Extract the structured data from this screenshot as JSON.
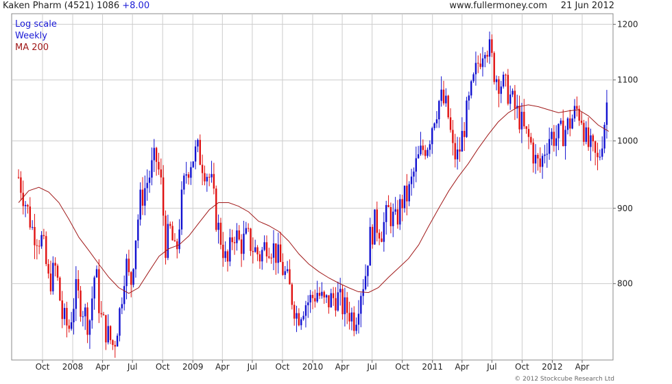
{
  "header": {
    "instrument": "Kaken Pharm (4521) 1086",
    "change": "+8.00",
    "site": "www.fullermoney.com",
    "date": "21 Jun 2012"
  },
  "legend": {
    "scale": "Log scale",
    "period": "Weekly",
    "ma": "MA 200"
  },
  "copyright": "© 2012 Stockcube Research Ltd",
  "colors": {
    "up": "#1010d0",
    "down": "#e01010",
    "ma": "#a01818",
    "grid": "#cccccc",
    "legend_scale": "#1a1ad6",
    "legend_period": "#1a1ad6",
    "legend_ma": "#a01818"
  },
  "chart_data": {
    "type": "candlestick",
    "y_scale": "log",
    "ylim": [
      710,
      1220
    ],
    "y_ticks": [
      800,
      900,
      1000,
      1100,
      1200
    ],
    "x_ticks": [
      {
        "label": "Oct",
        "date": "2007-10-01"
      },
      {
        "label": "2008",
        "date": "2008-01-01"
      },
      {
        "label": "Apr",
        "date": "2008-04-01"
      },
      {
        "label": "Jul",
        "date": "2008-07-01"
      },
      {
        "label": "Oct",
        "date": "2008-10-01"
      },
      {
        "label": "2009",
        "date": "2009-01-01"
      },
      {
        "label": "Apr",
        "date": "2009-04-01"
      },
      {
        "label": "Jul",
        "date": "2009-07-01"
      },
      {
        "label": "Oct",
        "date": "2009-10-01"
      },
      {
        "label": "2010",
        "date": "2010-01-01"
      },
      {
        "label": "Apr",
        "date": "2010-04-01"
      },
      {
        "label": "Jul",
        "date": "2010-07-01"
      },
      {
        "label": "Oct",
        "date": "2010-10-01"
      },
      {
        "label": "2011",
        "date": "2011-01-01"
      },
      {
        "label": "Apr",
        "date": "2011-04-01"
      },
      {
        "label": "Jul",
        "date": "2011-07-01"
      },
      {
        "label": "Oct",
        "date": "2011-10-01"
      },
      {
        "label": "2012",
        "date": "2012-01-01"
      },
      {
        "label": "Apr",
        "date": "2012-04-01"
      }
    ],
    "grid": true,
    "close_series": [
      [
        "2007-07-20",
        945
      ],
      [
        "2007-09-01",
        870
      ],
      [
        "2007-10-01",
        855
      ],
      [
        "2007-10-20",
        800
      ],
      [
        "2007-11-10",
        820
      ],
      [
        "2007-11-30",
        760
      ],
      [
        "2007-12-20",
        745
      ],
      [
        "2008-01-10",
        790
      ],
      [
        "2008-02-01",
        770
      ],
      [
        "2008-02-20",
        750
      ],
      [
        "2008-03-10",
        820
      ],
      [
        "2008-03-25",
        760
      ],
      [
        "2008-04-15",
        740
      ],
      [
        "2008-05-05",
        725
      ],
      [
        "2008-05-25",
        770
      ],
      [
        "2008-06-10",
        830
      ],
      [
        "2008-06-25",
        795
      ],
      [
        "2008-07-10",
        860
      ],
      [
        "2008-07-25",
        910
      ],
      [
        "2008-08-20",
        945
      ],
      [
        "2008-09-10",
        975
      ],
      [
        "2008-09-25",
        940
      ],
      [
        "2008-10-10",
        850
      ],
      [
        "2008-10-25",
        870
      ],
      [
        "2008-11-10",
        830
      ],
      [
        "2008-11-25",
        900
      ],
      [
        "2008-12-10",
        950
      ],
      [
        "2008-12-25",
        970
      ],
      [
        "2009-01-15",
        985
      ],
      [
        "2009-02-05",
        960
      ],
      [
        "2009-02-25",
        940
      ],
      [
        "2009-03-15",
        880
      ],
      [
        "2009-04-01",
        850
      ],
      [
        "2009-04-15",
        820
      ],
      [
        "2009-05-05",
        870
      ],
      [
        "2009-05-25",
        850
      ],
      [
        "2009-06-15",
        860
      ],
      [
        "2009-07-05",
        845
      ],
      [
        "2009-07-25",
        835
      ],
      [
        "2009-08-15",
        855
      ],
      [
        "2009-09-05",
        845
      ],
      [
        "2009-09-25",
        825
      ],
      [
        "2009-10-10",
        810
      ],
      [
        "2009-10-25",
        790
      ],
      [
        "2009-11-15",
        760
      ],
      [
        "2009-12-05",
        775
      ],
      [
        "2009-12-25",
        780
      ],
      [
        "2010-01-15",
        790
      ],
      [
        "2010-02-05",
        775
      ],
      [
        "2010-02-25",
        780
      ],
      [
        "2010-03-15",
        785
      ],
      [
        "2010-04-05",
        770
      ],
      [
        "2010-04-25",
        765
      ],
      [
        "2010-05-10",
        755
      ],
      [
        "2010-05-25",
        790
      ],
      [
        "2010-06-10",
        810
      ],
      [
        "2010-06-25",
        860
      ],
      [
        "2010-07-10",
        880
      ],
      [
        "2010-07-30",
        870
      ],
      [
        "2010-08-20",
        895
      ],
      [
        "2010-09-10",
        880
      ],
      [
        "2010-09-30",
        910
      ],
      [
        "2010-10-20",
        920
      ],
      [
        "2010-11-10",
        960
      ],
      [
        "2010-11-30",
        985
      ],
      [
        "2010-12-20",
        1000
      ],
      [
        "2011-01-05",
        1040
      ],
      [
        "2011-01-25",
        1070
      ],
      [
        "2011-02-15",
        1050
      ],
      [
        "2011-03-05",
        980
      ],
      [
        "2011-03-20",
        975
      ],
      [
        "2011-04-10",
        1030
      ],
      [
        "2011-04-30",
        1080
      ],
      [
        "2011-05-20",
        1130
      ],
      [
        "2011-06-10",
        1170
      ],
      [
        "2011-06-25",
        1150
      ],
      [
        "2011-07-10",
        1110
      ],
      [
        "2011-07-30",
        1095
      ],
      [
        "2011-08-20",
        1080
      ],
      [
        "2011-09-10",
        1050
      ],
      [
        "2011-09-25",
        1035
      ],
      [
        "2011-10-10",
        1010
      ],
      [
        "2011-10-25",
        1000
      ],
      [
        "2011-11-10",
        970
      ],
      [
        "2011-11-25",
        960
      ],
      [
        "2011-12-10",
        990
      ],
      [
        "2011-12-25",
        1010
      ],
      [
        "2012-01-15",
        1005
      ],
      [
        "2012-02-05",
        1015
      ],
      [
        "2012-02-25",
        1030
      ],
      [
        "2012-03-15",
        1050
      ],
      [
        "2012-03-30",
        1040
      ],
      [
        "2012-04-15",
        995
      ],
      [
        "2012-04-30",
        985
      ],
      [
        "2012-05-20",
        965
      ],
      [
        "2012-06-05",
        1020
      ],
      [
        "2012-06-21",
        1086
      ]
    ],
    "ma200": [
      [
        "2007-07-20",
        908
      ],
      [
        "2007-08-20",
        925
      ],
      [
        "2007-09-20",
        930
      ],
      [
        "2007-10-20",
        923
      ],
      [
        "2007-11-20",
        908
      ],
      [
        "2007-12-20",
        885
      ],
      [
        "2008-01-20",
        860
      ],
      [
        "2008-02-20",
        842
      ],
      [
        "2008-03-20",
        825
      ],
      [
        "2008-04-20",
        808
      ],
      [
        "2008-05-20",
        795
      ],
      [
        "2008-06-20",
        788
      ],
      [
        "2008-07-20",
        795
      ],
      [
        "2008-08-20",
        815
      ],
      [
        "2008-09-20",
        835
      ],
      [
        "2008-10-20",
        845
      ],
      [
        "2008-11-20",
        850
      ],
      [
        "2008-12-20",
        862
      ],
      [
        "2009-01-20",
        880
      ],
      [
        "2009-02-20",
        898
      ],
      [
        "2009-03-20",
        908
      ],
      [
        "2009-04-20",
        908
      ],
      [
        "2009-05-20",
        903
      ],
      [
        "2009-06-20",
        895
      ],
      [
        "2009-07-20",
        882
      ],
      [
        "2009-08-20",
        876
      ],
      [
        "2009-09-20",
        868
      ],
      [
        "2009-10-20",
        855
      ],
      [
        "2009-11-20",
        838
      ],
      [
        "2009-12-20",
        825
      ],
      [
        "2010-01-20",
        815
      ],
      [
        "2010-02-20",
        807
      ],
      [
        "2010-03-20",
        801
      ],
      [
        "2010-04-20",
        795
      ],
      [
        "2010-05-20",
        790
      ],
      [
        "2010-06-20",
        789
      ],
      [
        "2010-07-20",
        795
      ],
      [
        "2010-08-20",
        808
      ],
      [
        "2010-09-20",
        820
      ],
      [
        "2010-10-20",
        832
      ],
      [
        "2010-11-20",
        850
      ],
      [
        "2010-12-20",
        875
      ],
      [
        "2011-01-20",
        900
      ],
      [
        "2011-02-20",
        925
      ],
      [
        "2011-03-20",
        945
      ],
      [
        "2011-04-20",
        965
      ],
      [
        "2011-05-20",
        988
      ],
      [
        "2011-06-20",
        1010
      ],
      [
        "2011-07-20",
        1030
      ],
      [
        "2011-08-20",
        1045
      ],
      [
        "2011-09-20",
        1055
      ],
      [
        "2011-10-20",
        1058
      ],
      [
        "2011-11-20",
        1055
      ],
      [
        "2011-12-20",
        1050
      ],
      [
        "2012-01-20",
        1045
      ],
      [
        "2012-02-20",
        1048
      ],
      [
        "2012-03-20",
        1050
      ],
      [
        "2012-04-20",
        1040
      ],
      [
        "2012-05-20",
        1025
      ],
      [
        "2012-06-21",
        1015
      ]
    ]
  }
}
